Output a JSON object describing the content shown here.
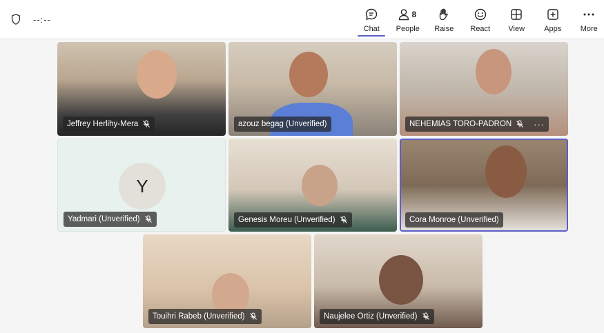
{
  "header": {
    "timer": "--:--"
  },
  "toolbar": {
    "chat_label": "Chat",
    "people_label": "People",
    "people_count": "8",
    "raise_label": "Raise",
    "react_label": "React",
    "view_label": "View",
    "apps_label": "Apps",
    "more_label": "More"
  },
  "participants": [
    {
      "name": "Jeffrey Herlihy-Mera",
      "muted": true
    },
    {
      "name": "azouz begag (Unverified)",
      "muted": false
    },
    {
      "name": "NEHEMIAS TORO-PADRON",
      "muted": true,
      "more": "···"
    },
    {
      "name": "Yadmari (Unverified)",
      "muted": true,
      "initial": "Y"
    },
    {
      "name": "Genesis Moreu (Unverified)",
      "muted": true
    },
    {
      "name": "Cora Monroe (Unverified)",
      "muted": false,
      "speaking": true
    },
    {
      "name": "Touihri Rabeb (Unverified)",
      "muted": true
    },
    {
      "name": "Naujelee Ortiz (Unverified)",
      "muted": true
    }
  ],
  "colors": {
    "accent": "#5b5fc7",
    "label_bg": "#242424"
  }
}
